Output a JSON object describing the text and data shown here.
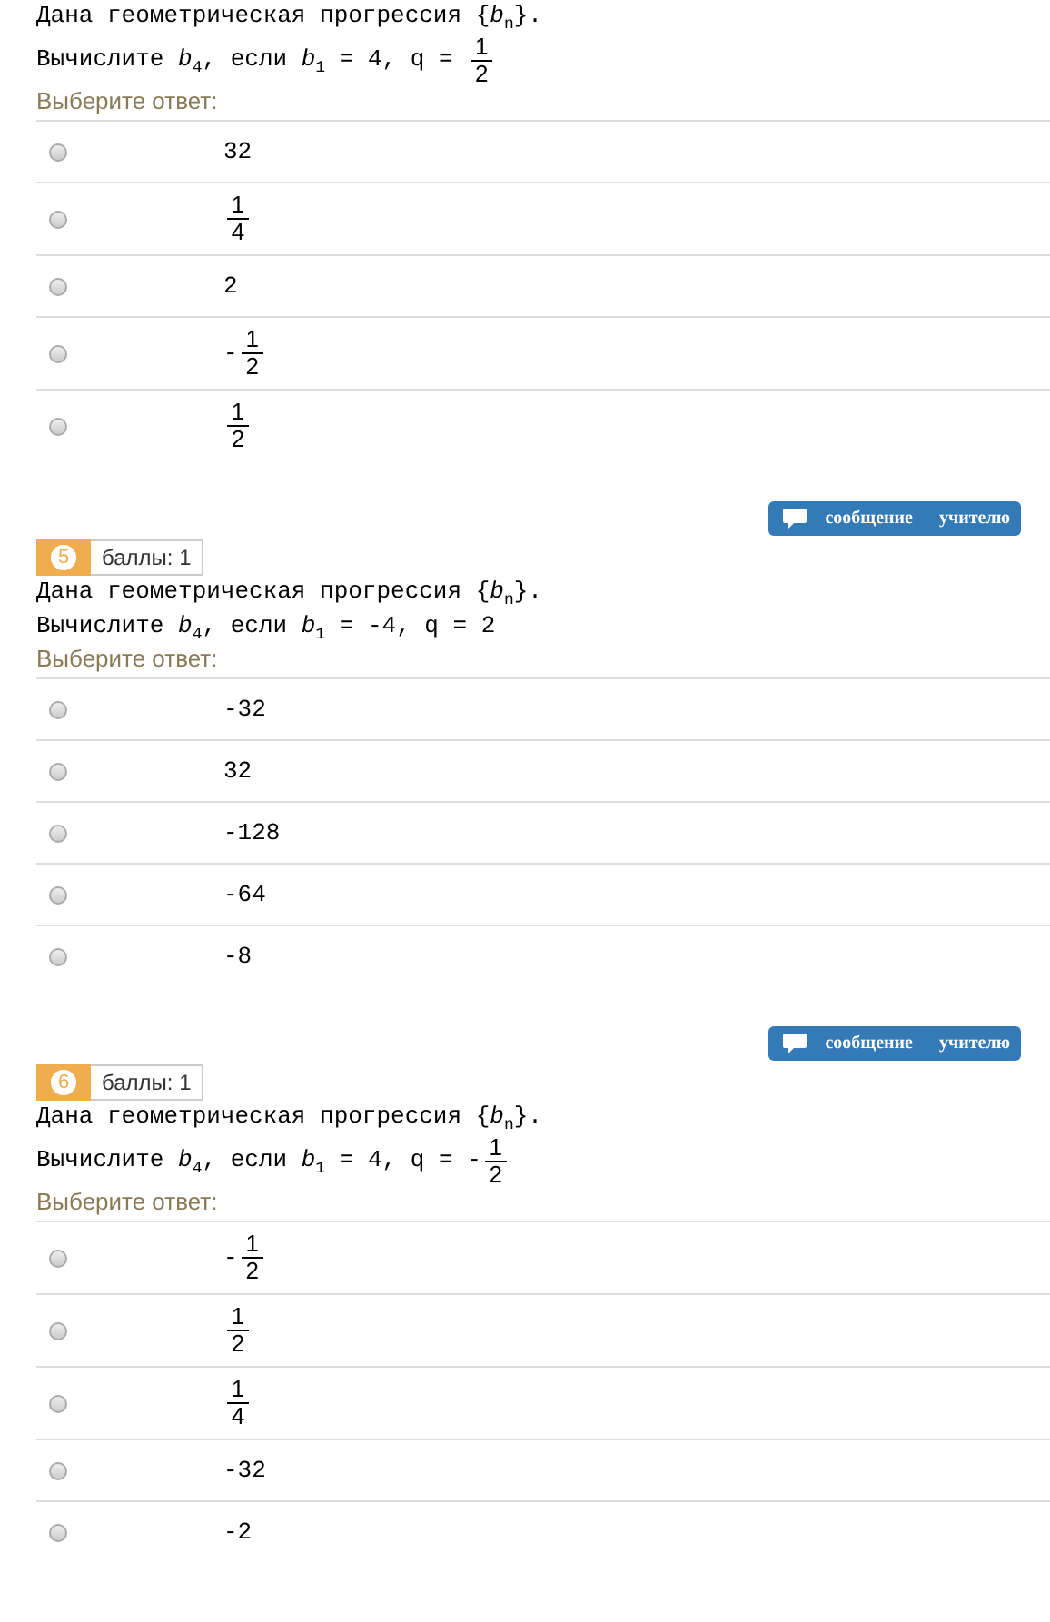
{
  "questions": [
    {
      "statement": [
        [
          {
            "kind": "text",
            "text": "Дана геометрическая прогрессия {*b*$_{n}$}."
          }
        ],
        [
          {
            "kind": "text",
            "text": "Вычислите *b*$_{4}$, если *b*$_{1}$ = 4, q = "
          },
          {
            "kind": "frac",
            "num": "1",
            "den": "2"
          }
        ]
      ],
      "prompt": "Выберите ответ:",
      "options": [
        {
          "selected": false,
          "parts": [
            {
              "kind": "text",
              "text": "32"
            }
          ]
        },
        {
          "selected": false,
          "parts": [
            {
              "kind": "frac",
              "num": "1",
              "den": "4"
            }
          ]
        },
        {
          "selected": false,
          "parts": [
            {
              "kind": "text",
              "text": "2"
            }
          ]
        },
        {
          "selected": false,
          "parts": [
            {
              "kind": "text",
              "text": "-"
            },
            {
              "kind": "frac",
              "num": "1",
              "den": "2"
            }
          ]
        },
        {
          "selected": false,
          "parts": [
            {
              "kind": "frac",
              "num": "1",
              "den": "2"
            }
          ]
        }
      ]
    },
    {
      "message_button": "сообщение учителю",
      "number": "5",
      "points": "баллы: 1",
      "statement": [
        [
          {
            "kind": "text",
            "text": "Дана геометрическая прогрессия {*b*$_{n}$}."
          }
        ],
        [
          {
            "kind": "text",
            "text": "Вычислите *b*$_{4}$, если *b*$_{1}$ = -4, q = 2"
          }
        ]
      ],
      "prompt": "Выберите ответ:",
      "options": [
        {
          "selected": false,
          "parts": [
            {
              "kind": "text",
              "text": "-32"
            }
          ]
        },
        {
          "selected": false,
          "parts": [
            {
              "kind": "text",
              "text": "32"
            }
          ]
        },
        {
          "selected": false,
          "parts": [
            {
              "kind": "text",
              "text": "-128"
            }
          ]
        },
        {
          "selected": false,
          "parts": [
            {
              "kind": "text",
              "text": "-64"
            }
          ]
        },
        {
          "selected": false,
          "parts": [
            {
              "kind": "text",
              "text": "-8"
            }
          ]
        }
      ]
    },
    {
      "message_button": "сообщение учителю",
      "number": "6",
      "points": "баллы: 1",
      "statement": [
        [
          {
            "kind": "text",
            "text": "Дана геометрическая прогрессия {*b*$_{n}$}."
          }
        ],
        [
          {
            "kind": "text",
            "text": "Вычислите *b*$_{4}$, если *b*$_{1}$ = 4, q = -"
          },
          {
            "kind": "frac",
            "num": "1",
            "den": "2"
          }
        ]
      ],
      "prompt": "Выберите ответ:",
      "options": [
        {
          "selected": false,
          "parts": [
            {
              "kind": "text",
              "text": "-"
            },
            {
              "kind": "frac",
              "num": "1",
              "den": "2"
            }
          ]
        },
        {
          "selected": false,
          "parts": [
            {
              "kind": "frac",
              "num": "1",
              "den": "2"
            }
          ]
        },
        {
          "selected": false,
          "parts": [
            {
              "kind": "frac",
              "num": "1",
              "den": "4"
            }
          ]
        },
        {
          "selected": false,
          "parts": [
            {
              "kind": "text",
              "text": "-32"
            }
          ]
        },
        {
          "selected": false,
          "parts": [
            {
              "kind": "text",
              "text": "-2"
            }
          ]
        }
      ]
    }
  ]
}
